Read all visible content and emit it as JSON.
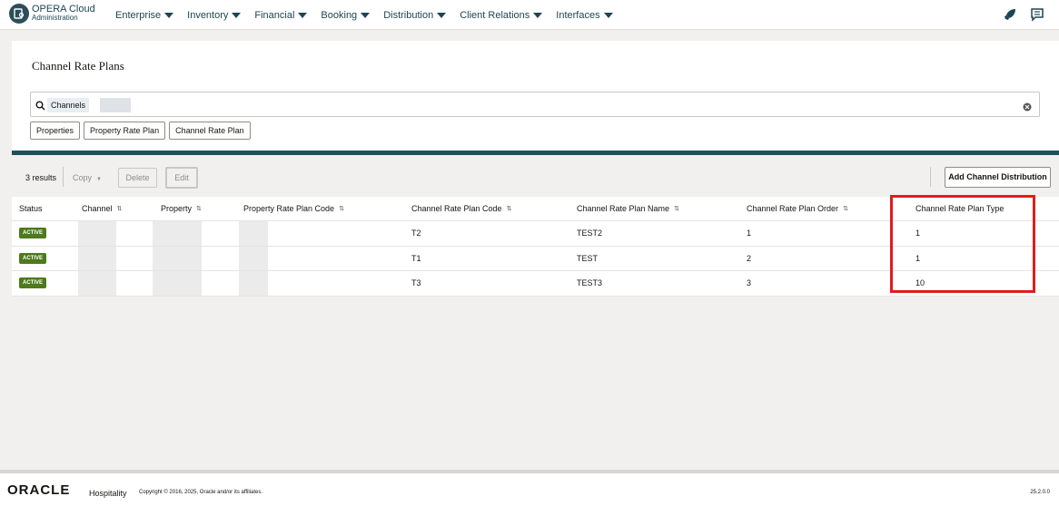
{
  "header": {
    "app_title": "OPERA Cloud",
    "app_subtitle": "Administration",
    "nav": [
      "Enterprise",
      "Inventory",
      "Financial",
      "Booking",
      "Distribution",
      "Client Relations",
      "Interfaces"
    ]
  },
  "page": {
    "title": "Channel Rate Plans"
  },
  "search": {
    "chip": "Channels"
  },
  "filter_chips": [
    "Properties",
    "Property Rate Plan",
    "Channel Rate Plan"
  ],
  "toolbar": {
    "results": "3 results",
    "copy": "Copy",
    "delete": "Delete",
    "edit": "Edit",
    "add": "Add Channel Distribution"
  },
  "table": {
    "headers": [
      "Status",
      "Channel",
      "Property",
      "Property Rate Plan Code",
      "Channel Rate Plan Code",
      "Channel Rate Plan Name",
      "Channel Rate Plan Order",
      "Channel Rate Plan Type"
    ],
    "rows": [
      {
        "status": "ACTIVE",
        "code": "T2",
        "name": "TEST2",
        "order": "1",
        "type": "1"
      },
      {
        "status": "ACTIVE",
        "code": "T1",
        "name": "TEST",
        "order": "2",
        "type": "1"
      },
      {
        "status": "ACTIVE",
        "code": "T3",
        "name": "TEST3",
        "order": "3",
        "type": "10"
      }
    ]
  },
  "footer": {
    "brand": "ORACLE",
    "product": "Hospitality",
    "copyright": "Copyright © 2016, 2025, Oracle and/or its affiliates.",
    "version": "25.2.0.0"
  },
  "colors": {
    "accent": "#1d4f5d",
    "badge": "#4c7a1c",
    "highlight": "#e31b1b"
  }
}
